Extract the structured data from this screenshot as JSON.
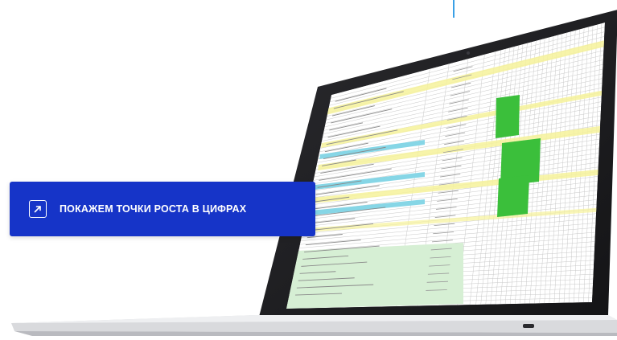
{
  "cta": {
    "label": "ПОКАЖЕМ ТОЧКИ РОСТА В ЦИФРАХ",
    "icon": "arrow-up-right-icon"
  },
  "colors": {
    "cta_background": "#1634c8",
    "accent_line": "#3aa0e6",
    "spreadsheet_highlight_green": "#3bbf3b",
    "spreadsheet_highlight_yellow": "#f6f29a",
    "spreadsheet_highlight_cyan": "#86d6e6",
    "laptop_frame": "#1c1c1f",
    "laptop_base": "#d9dadd"
  }
}
